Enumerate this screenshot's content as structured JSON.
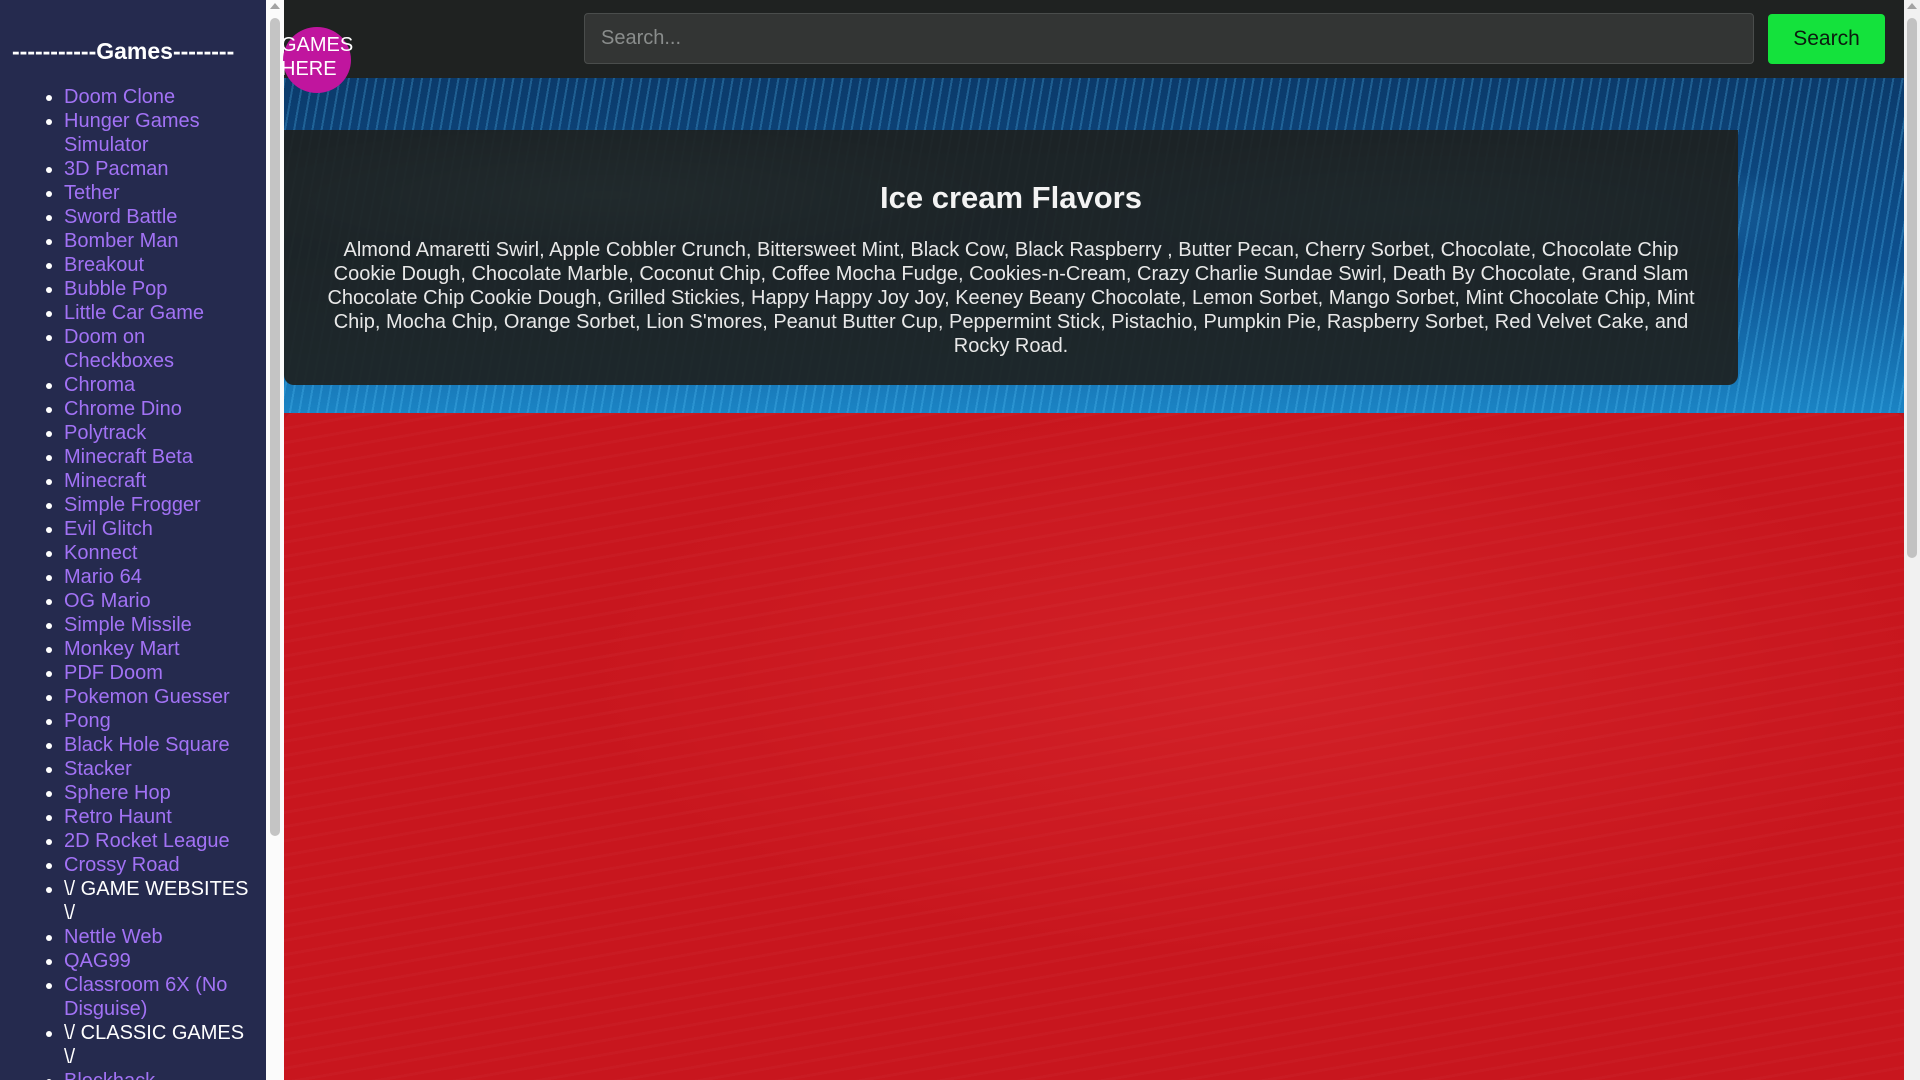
{
  "search": {
    "placeholder": "Search...",
    "button_label": "Search"
  },
  "badge": {
    "label": "GAMES HERE"
  },
  "card": {
    "title": "Ice cream Flavors",
    "text": "Almond Amaretti Swirl, Apple Cobbler Crunch, Bittersweet Mint, Black Cow, Black Raspberry , Butter Pecan, Cherry Sorbet, Chocolate, Chocolate Chip Cookie Dough, Chocolate Marble, Coconut Chip, Coffee Mocha Fudge, Cookies-n-Cream, Crazy Charlie Sundae Swirl, Death By Chocolate, Grand Slam Chocolate Chip Cookie Dough, Grilled Stickies, Happy Happy Joy Joy, Keeney Beany Chocolate, Lemon Sorbet, Mango Sorbet, Mint Chocolate Chip, Mint Chip, Mocha Chip, Orange Sorbet, Lion S'mores, Peanut Butter Cup, Peppermint Stick, Pistachio, Pumpkin Pie, Raspberry Sorbet, Red Velvet Cake, and Rocky Road."
  },
  "sidebar": {
    "title": "-----------Games--------",
    "items": [
      {
        "label": "Doom Clone",
        "type": "link"
      },
      {
        "label": "Hunger Games Simulator",
        "type": "link"
      },
      {
        "label": "3D Pacman",
        "type": "link"
      },
      {
        "label": "Tether",
        "type": "link"
      },
      {
        "label": "Sword Battle",
        "type": "link"
      },
      {
        "label": "Bomber Man",
        "type": "link"
      },
      {
        "label": "Breakout",
        "type": "link"
      },
      {
        "label": "Bubble Pop",
        "type": "link"
      },
      {
        "label": "Little Car Game",
        "type": "link"
      },
      {
        "label": "Doom on Checkboxes",
        "type": "link"
      },
      {
        "label": "Chroma",
        "type": "link"
      },
      {
        "label": "Chrome Dino",
        "type": "link"
      },
      {
        "label": "Polytrack",
        "type": "link"
      },
      {
        "label": "Minecraft Beta",
        "type": "link"
      },
      {
        "label": "Minecraft",
        "type": "link"
      },
      {
        "label": "Simple Frogger",
        "type": "link"
      },
      {
        "label": "Evil Glitch",
        "type": "link"
      },
      {
        "label": "Konnect",
        "type": "link"
      },
      {
        "label": "Mario 64",
        "type": "link"
      },
      {
        "label": "OG Mario",
        "type": "link"
      },
      {
        "label": "Simple Missile",
        "type": "link"
      },
      {
        "label": "Monkey Mart",
        "type": "link"
      },
      {
        "label": "PDF Doom",
        "type": "link"
      },
      {
        "label": "Pokemon Guesser",
        "type": "link"
      },
      {
        "label": "Pong",
        "type": "link"
      },
      {
        "label": "Black Hole Square",
        "type": "link"
      },
      {
        "label": "Stacker",
        "type": "link"
      },
      {
        "label": "Sphere Hop",
        "type": "link"
      },
      {
        "label": "Retro Haunt",
        "type": "link"
      },
      {
        "label": "2D Rocket League",
        "type": "link"
      },
      {
        "label": "Crossy Road",
        "type": "link"
      },
      {
        "label": "\\/ GAME WEBSITES \\/",
        "type": "heading"
      },
      {
        "label": "Nettle Web",
        "type": "link"
      },
      {
        "label": "QAG99",
        "type": "link"
      },
      {
        "label": "Classroom 6X (No Disguise)",
        "type": "link"
      },
      {
        "label": "\\/ CLASSIC GAMES \\/",
        "type": "heading"
      },
      {
        "label": "Blockhack",
        "type": "link"
      }
    ]
  },
  "colors": {
    "sidebar_bg": "#252a4e",
    "link": "#a272f5",
    "search_button": "#14e23c",
    "badge": "#c0159e",
    "red_area": "#c8161e",
    "card_bg": "#1e2120"
  }
}
